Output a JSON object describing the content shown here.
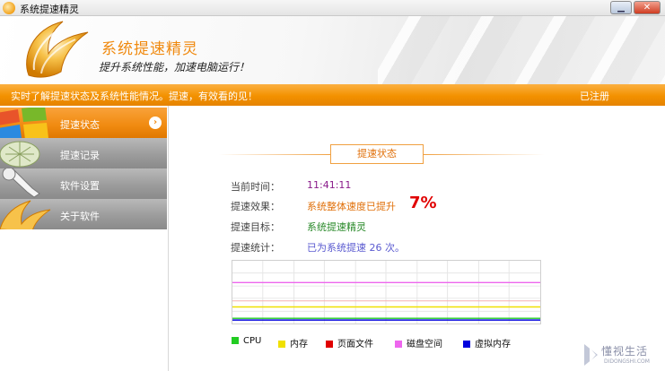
{
  "window": {
    "title": "系统提速精灵"
  },
  "header": {
    "app_name": "系统提速精灵",
    "slogan": "提升系统性能，加速电脑运行！"
  },
  "status_bar": {
    "message": "实时了解提速状态及系统性能情况。提速，有效看的见！",
    "registration": "已注册"
  },
  "sidebar": {
    "items": [
      {
        "label": "提速状态",
        "active": true
      },
      {
        "label": "提速记录",
        "active": false
      },
      {
        "label": "软件设置",
        "active": false
      },
      {
        "label": "关于软件",
        "active": false
      }
    ]
  },
  "main": {
    "section_title": "提速状态",
    "rows": [
      {
        "label": "当前时间：",
        "value": "11:41:11"
      },
      {
        "label": "提速效果：",
        "value": "系统整体速度已提升",
        "extra": "7%"
      },
      {
        "label": "提速目标：",
        "value": "系统提速精灵"
      },
      {
        "label": "提速统计：",
        "value": "已为系统提速 26 次。"
      }
    ],
    "legend": [
      {
        "label": "CPU",
        "color": "#22cc22"
      },
      {
        "label": "内存",
        "color": "#f0e000"
      },
      {
        "label": "页面文件",
        "color": "#e00000"
      },
      {
        "label": "磁盘空间",
        "color": "#ee66ee"
      },
      {
        "label": "虚拟内存",
        "color": "#0000dd"
      }
    ]
  },
  "watermark": {
    "text": "懂视生活",
    "sub": "DIDONGSHI.COM"
  }
}
